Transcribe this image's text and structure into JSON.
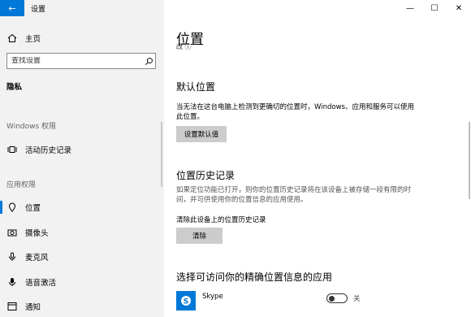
{
  "window": {
    "title": "设置",
    "controls": {
      "minimize": "—",
      "maximize": "☐",
      "close": "✕"
    }
  },
  "sidebar": {
    "home_label": "主页",
    "search_placeholder": "查找设置",
    "section_title": "隐私",
    "groups": [
      {
        "label": "Windows 权限",
        "items": [
          {
            "label": "活动历史记录",
            "icon": "activity-history-icon"
          }
        ]
      },
      {
        "label": "应用权限",
        "items": [
          {
            "label": "位置",
            "icon": "location-icon",
            "selected": true
          },
          {
            "label": "摄像头",
            "icon": "camera-icon"
          },
          {
            "label": "麦克风",
            "icon": "microphone-icon"
          },
          {
            "label": "语音激活",
            "icon": "voice-activation-icon"
          },
          {
            "label": "通知",
            "icon": "notifications-icon"
          }
        ]
      }
    ]
  },
  "main": {
    "page_title": "位置",
    "scrolled_text": "改 ⓘ",
    "default_location": {
      "heading": "默认位置",
      "description": "当无法在这台电脑上检测到更确切的位置时，Windows、应用和服务可以使用此位置。",
      "button": "设置默认值"
    },
    "location_history": {
      "heading": "位置历史记录",
      "description": "如果定位功能已打开，则你的位置历史记录将在该设备上被存储一段有限的时间，并可供使用你的位置信息的应用使用。",
      "clear_label": "清除此设备上的位置历史记录",
      "clear_button": "清除"
    },
    "apps_section": {
      "heading": "选择可访问你的精确位置信息的应用",
      "apps": [
        {
          "name": "Skype",
          "state": "关",
          "enabled": false
        }
      ]
    }
  },
  "colors": {
    "accent": "#0078d7",
    "sidebar_bg": "#f2f2f2",
    "button_bg": "#cccccc"
  }
}
